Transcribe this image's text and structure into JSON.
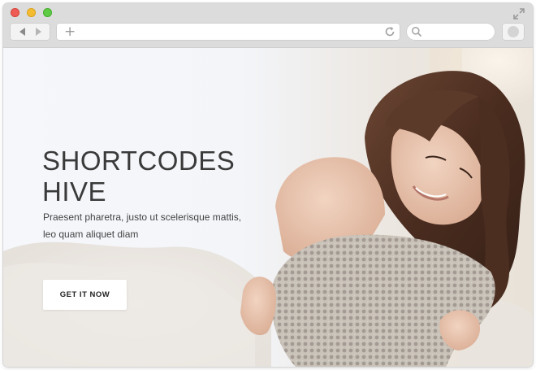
{
  "hero": {
    "title_line1": "SHORTCODES",
    "title_line2": "HIVE",
    "subtitle_line1": "Praesent pharetra, justo ut scelerisque mattis,",
    "subtitle_line2": "leo quam aliquet diam",
    "cta_label": "GET IT NOW"
  },
  "icons": {
    "window_close": "close-dot-icon",
    "window_minimize": "minimize-dot-icon",
    "window_maximize": "maximize-dot-icon",
    "expand": "expand-arrows-icon",
    "back": "back-arrow-icon",
    "forward": "forward-arrow-icon",
    "new_tab": "plus-icon",
    "reload": "reload-icon",
    "search": "search-icon",
    "extension": "extension-icon"
  },
  "colors": {
    "chrome_background": "#dcdcdc",
    "close": "#ee5c55",
    "minimize": "#f4bd31",
    "maximize": "#5ecb44",
    "title_text": "#3a3a3a",
    "cta_background": "#ffffff"
  }
}
